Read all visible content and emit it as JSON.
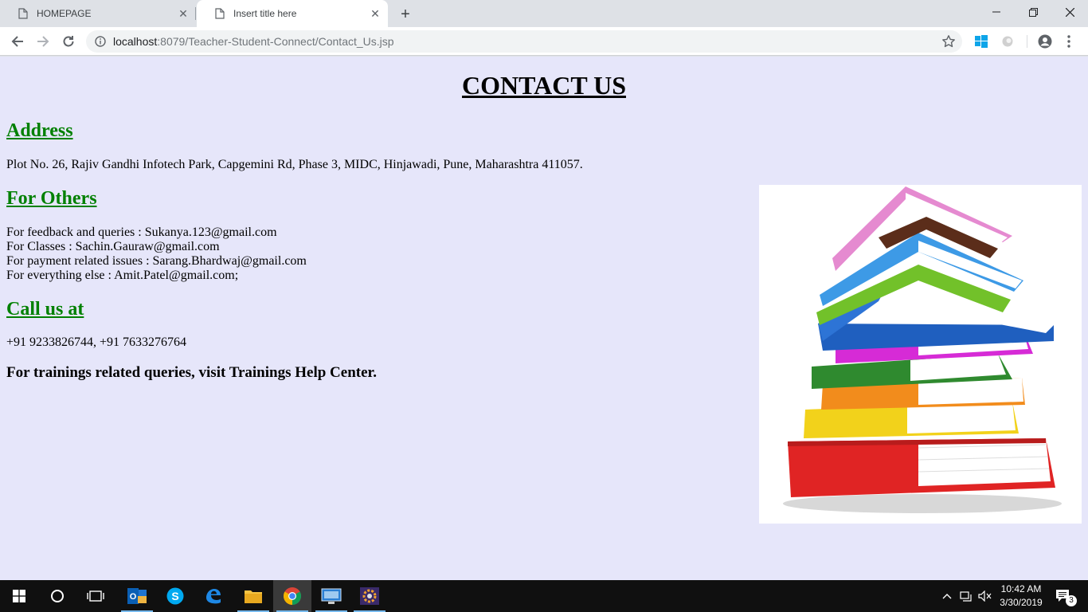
{
  "browser": {
    "tabs": [
      {
        "label": "HOMEPAGE"
      },
      {
        "label": "Insert title here"
      }
    ],
    "url_host": "localhost",
    "url_rest": ":8079/Teacher-Student-Connect/Contact_Us.jsp"
  },
  "page": {
    "title": "CONTACT US",
    "address_heading": "Address",
    "address_text": "Plot No. 26, Rajiv Gandhi Infotech Park, Capgemini Rd, Phase 3, MIDC, Hinjawadi, Pune, Maharashtra 411057.",
    "others_heading": "For Others",
    "contacts": [
      "For feedback and queries : Sukanya.123@gmail.com",
      "For Classes : Sachin.Gauraw@gmail.com",
      "For payment related issues : Sarang.Bhardwaj@gmail.com",
      "For everything else : Amit.Patel@gmail.com;"
    ],
    "call_heading": "Call us at",
    "phones": "+91 9233826744, +91 7633276764",
    "trainings_text": "For trainings related queries, visit Trainings Help Center.",
    "background": "#e6e6fa",
    "heading_color": "#008000"
  },
  "taskbar": {
    "time": "10:42 AM",
    "date": "3/30/2019",
    "notification_count": "3"
  }
}
